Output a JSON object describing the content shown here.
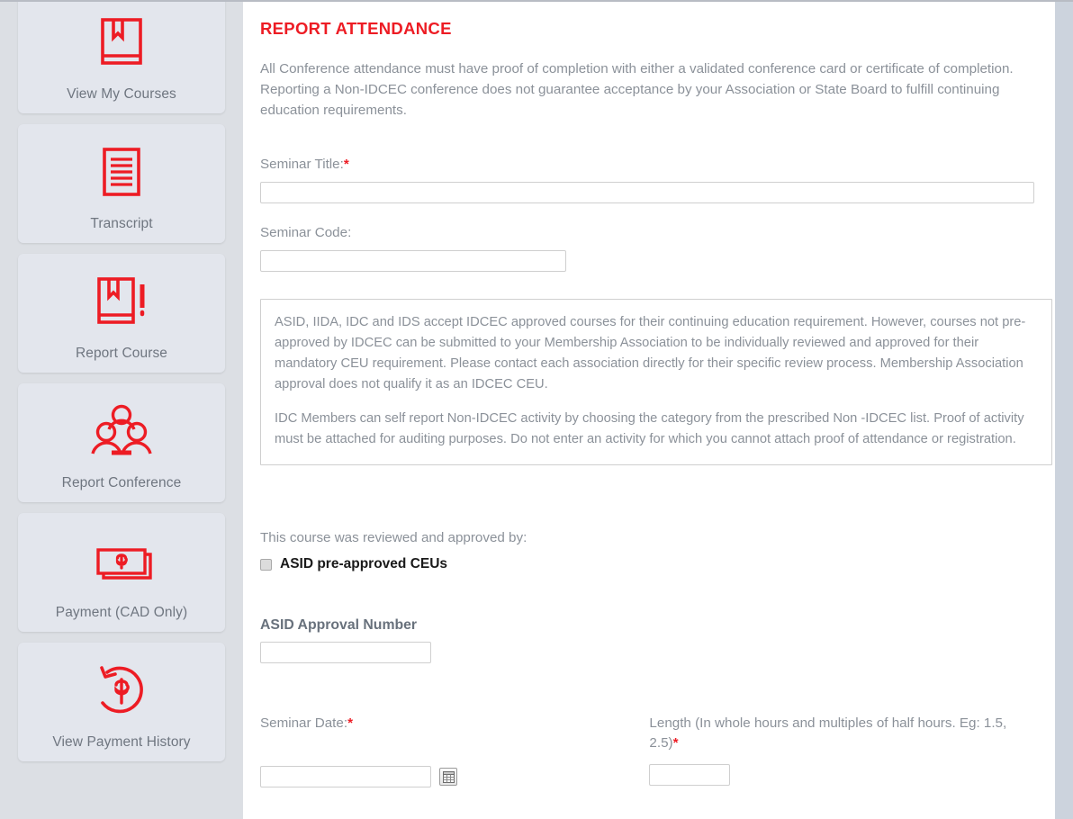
{
  "sidebar": {
    "items": [
      {
        "label": "View My Courses",
        "icon": "book-icon"
      },
      {
        "label": "Transcript",
        "icon": "document-lines-icon"
      },
      {
        "label": "Report Course",
        "icon": "book-pencil-icon"
      },
      {
        "label": "Report Conference",
        "icon": "people-group-icon"
      },
      {
        "label": "Payment (CAD Only)",
        "icon": "money-bills-icon"
      },
      {
        "label": "View Payment History",
        "icon": "refund-circle-dollar-icon"
      }
    ]
  },
  "main": {
    "page_title": "REPORT ATTENDANCE",
    "intro_line_1": "All Conference attendance must have proof of completion with either a validated conference card or certificate of completion.",
    "intro_line_2": "Reporting a Non-IDCEC conference does not guarantee acceptance by your Association or State Board to fulfill continuing education requirements.",
    "seminar_title_label": "Seminar Title:",
    "seminar_title_value": "",
    "seminar_code_label": "Seminar Code:",
    "seminar_code_value": "",
    "info_paragraph_1": "ASID, IIDA, IDC and IDS accept IDCEC approved courses for their continuing education requirement. However, courses not pre-approved by IDCEC can be submitted to your Membership Association to be individually reviewed and approved for their mandatory CEU requirement. Please contact each association directly for their specific review process. Membership Association approval does not qualify it as an IDCEC CEU.",
    "info_paragraph_2": "IDC Members can self report Non-IDCEC activity by choosing the category from the prescribed Non -IDCEC list. Proof of activity must be attached for auditing purposes. Do not enter an activity for which you cannot attach proof of attendance or registration.",
    "approved_by_label": "This course was reviewed and approved by:",
    "asid_checkbox_label": "ASID pre-approved CEUs",
    "asid_checkbox_checked": false,
    "asid_approval_number_label": "ASID Approval Number",
    "asid_approval_number_value": "",
    "seminar_date_label": "Seminar Date:",
    "seminar_date_value": "",
    "length_label": "Length (In whole hours and multiples of half hours. Eg: 1.5, 2.5)",
    "length_value": "",
    "required_marker": "*"
  },
  "colors": {
    "brand_red": "#ed1c24",
    "label_gray": "#8b9199",
    "sidebar_bg": "#dcdfe4",
    "card_bg": "#e3e6ed",
    "scrollbar": "#ccd3dd"
  }
}
